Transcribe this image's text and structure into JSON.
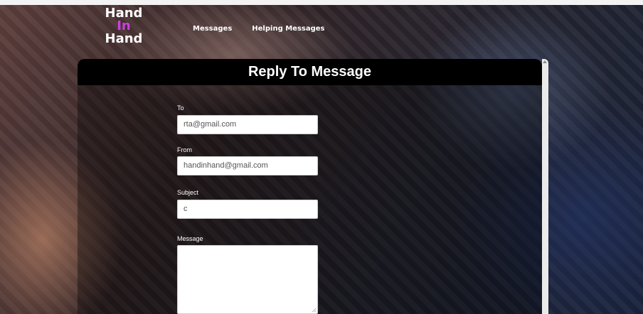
{
  "brand": {
    "line1": "Hand",
    "line2": "In",
    "line3": "Hand",
    "accent_color": "#c93fe3"
  },
  "nav": {
    "items": [
      {
        "label": "Messages"
      },
      {
        "label": "Helping Messages"
      }
    ]
  },
  "panel": {
    "title": "Reply To Message"
  },
  "form": {
    "to": {
      "label": "To",
      "value": "rta@gmail.com"
    },
    "from": {
      "label": "From",
      "value": "handinhand@gmail.com"
    },
    "subject": {
      "label": "Subject",
      "value": "c"
    },
    "message": {
      "label": "Message",
      "value": ""
    }
  }
}
